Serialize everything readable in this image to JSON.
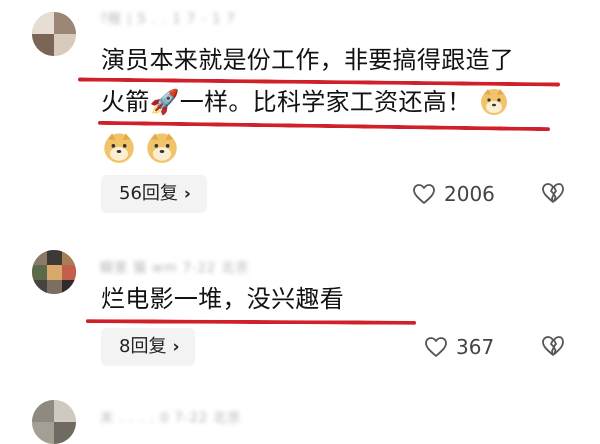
{
  "comments": [
    {
      "meta": "?程 | 5 . . 1 7 - 1 7",
      "lines": [
        "演员本来就是份工作，非要搞得跟造了",
        "火箭🚀一样。比科学家工资还高！"
      ],
      "reply_label": "56回复",
      "likes": "2006"
    },
    {
      "meta": "糊里 猫 wm 7-22 北京",
      "lines": [
        "烂电影一堆，没兴趣看"
      ],
      "reply_label": "8回复",
      "likes": "367"
    },
    {
      "meta": "关 . . . . 0 7-22 北京"
    }
  ],
  "icons": [
    "heart-outline-icon",
    "broken-heart-icon",
    "chevron-right-icon",
    "rocket-emoji",
    "doge-emoji"
  ],
  "colors": {
    "underline": "#d0202a",
    "button_bg": "#f3f3f3",
    "meta_text": "#b4b4b4"
  }
}
